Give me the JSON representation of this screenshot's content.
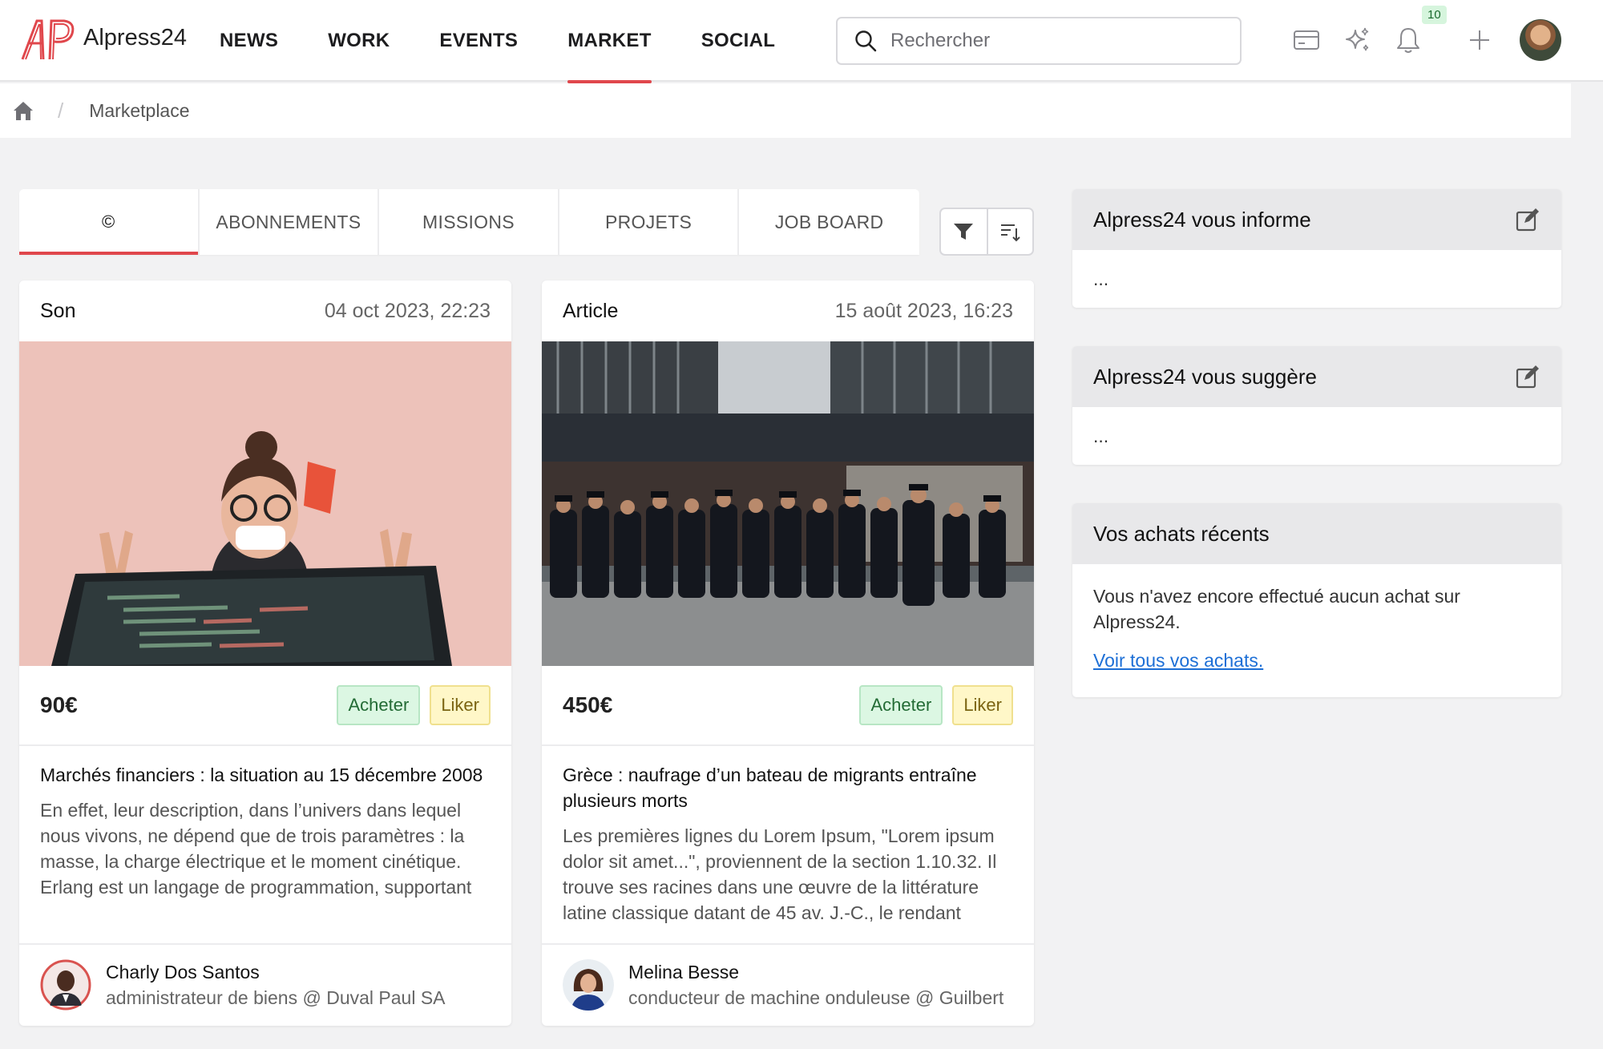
{
  "app": {
    "brand": "Alpress24"
  },
  "nav": {
    "items": [
      {
        "label": "NEWS"
      },
      {
        "label": "WORK"
      },
      {
        "label": "EVENTS"
      },
      {
        "label": "MARKET",
        "active": true
      },
      {
        "label": "SOCIAL"
      }
    ]
  },
  "search": {
    "placeholder": "Rechercher",
    "value": ""
  },
  "notifications": {
    "count": "10"
  },
  "breadcrumb": {
    "current": "Marketplace",
    "separator": "/"
  },
  "tabs": [
    {
      "label": "©",
      "active": true
    },
    {
      "label": "ABONNEMENTS"
    },
    {
      "label": "MISSIONS"
    },
    {
      "label": "PROJETS"
    },
    {
      "label": "JOB BOARD"
    }
  ],
  "cards": [
    {
      "type": "Son",
      "date": "04 oct 2023, 22:23",
      "price": "90€",
      "buy_label": "Acheter",
      "like_label": "Liker",
      "title": "Marchés financiers : la situation au 15 décembre 2008",
      "excerpt": "En effet, leur description, dans l’univers dans lequel nous vivons, ne dépend que de trois paramètres : la masse, la charge électrique et le moment cinétique. Erlang est un langage de programmation, supportant",
      "author": {
        "name": "Charly Dos Santos",
        "role": "administrateur de biens @ Duval Paul SA"
      }
    },
    {
      "type": "Article",
      "date": "15 août 2023, 16:23",
      "price": "450€",
      "buy_label": "Acheter",
      "like_label": "Liker",
      "title": "Grèce : naufrage d’un bateau de migrants entraîne plusieurs morts",
      "excerpt": "Les premières lignes du Lorem Ipsum, \"Lorem ipsum dolor sit amet...\", proviennent de la section 1.10.32. Il trouve ses racines dans une œuvre de la littérature latine classique datant de 45 av. J.-C., le rendant",
      "author": {
        "name": "Melina Besse",
        "role": "conducteur de machine onduleuse @ Guilbert"
      }
    }
  ],
  "sidebar": {
    "inform": {
      "title": "Alpress24 vous informe",
      "body": "..."
    },
    "suggest": {
      "title": "Alpress24 vous suggère",
      "body": "..."
    },
    "purchases": {
      "title": "Vos achats récents",
      "body": "Vous n'avez encore effectué aucun achat sur Alpress24.",
      "link": "Voir tous vos achats."
    }
  },
  "colors": {
    "accent": "#e0474c",
    "link": "#1d6fd6",
    "buy_bg": "#dcf7e3",
    "like_bg": "#fff7c8"
  },
  "icons": [
    "home-icon",
    "search-icon",
    "card-icon",
    "sparkles-icon",
    "bell-icon",
    "plus-icon",
    "filter-icon",
    "sort-icon",
    "edit-icon"
  ]
}
